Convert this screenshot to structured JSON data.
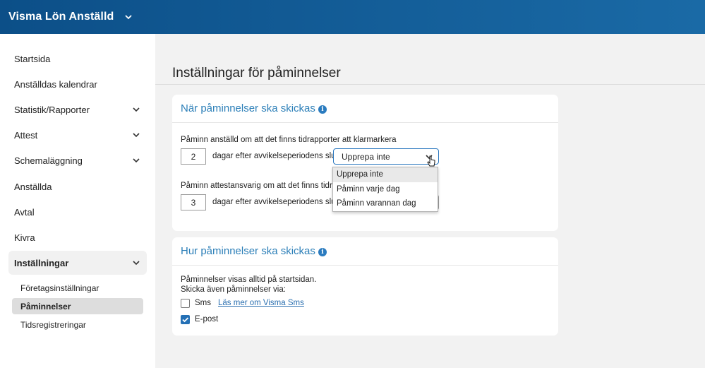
{
  "app": {
    "title": "Visma Lön Anställd"
  },
  "sidebar": {
    "items": [
      {
        "label": "Startsida"
      },
      {
        "label": "Anställdas kalendrar"
      },
      {
        "label": "Statistik/Rapporter"
      },
      {
        "label": "Attest"
      },
      {
        "label": "Schemaläggning"
      },
      {
        "label": "Anställda"
      },
      {
        "label": "Avtal"
      },
      {
        "label": "Kivra"
      },
      {
        "label": "Inställningar"
      }
    ],
    "sub_items": [
      {
        "label": "Företagsinställningar"
      },
      {
        "label": "Påminnelser"
      },
      {
        "label": "Tidsregistreringar"
      }
    ]
  },
  "page": {
    "title": "Inställningar för påminnelser"
  },
  "when_card": {
    "heading": "När påminnelser ska skickas",
    "row1": {
      "text": "Påminn anställd om att det finns tidrapporter att klarmarkera",
      "days": "2",
      "suffix": "dagar efter avvikelseperiodens slut",
      "selected": "Upprepa inte"
    },
    "row2": {
      "text": "Påminn attestansvarig om att det finns tidrapp",
      "days": "3",
      "suffix": "dagar efter avvikelseperiodens slut"
    },
    "dropdown_options": [
      "Upprepa inte",
      "Påminn varje dag",
      "Påminn varannan dag"
    ]
  },
  "how_card": {
    "heading": "Hur påminnelser ska skickas",
    "line1": "Påminnelser visas alltid på startsidan.",
    "line2": "Skicka även påminnelser via:",
    "sms_label": "Sms",
    "sms_link": "Läs mer om Visma Sms",
    "email_label": "E-post"
  },
  "colors": {
    "header": "#1467a2",
    "accent": "#2c7fb8",
    "checkbox": "#2470b5"
  }
}
